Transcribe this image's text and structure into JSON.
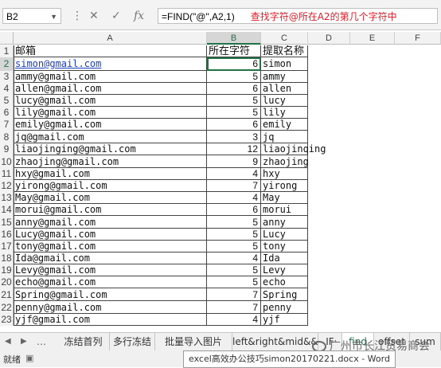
{
  "formula_bar": {
    "name_box": "B2",
    "formula": "=FIND(\"@\",A2,1)",
    "note": "查找字符@所在A2的第几个字符中",
    "note_color": "#e0202a",
    "icons": [
      "dropdown-icon",
      "cancel-icon",
      "confirm-icon",
      "fx-icon"
    ]
  },
  "columns": [
    "A",
    "B",
    "C",
    "D",
    "E",
    "F"
  ],
  "selected_cell": "B2",
  "table": {
    "headers": {
      "email": "邮箱",
      "position": "所在字符",
      "name": "提取名称"
    },
    "rows": [
      {
        "email": "simon@gmail.com",
        "pos": "6",
        "name": "simon"
      },
      {
        "email": "ammy@gmail.com",
        "pos": "5",
        "name": "ammy"
      },
      {
        "email": "allen@gmail.com",
        "pos": "6",
        "name": "allen"
      },
      {
        "email": "lucy@gmail.com",
        "pos": "5",
        "name": "lucy"
      },
      {
        "email": "lily@gmail.com",
        "pos": "5",
        "name": "lily"
      },
      {
        "email": "emily@gmail.com",
        "pos": "6",
        "name": "emily"
      },
      {
        "email": "jq@gmail.com",
        "pos": "3",
        "name": "jq"
      },
      {
        "email": "liaojinging@gmail.com",
        "pos": "12",
        "name": "liaojinqing"
      },
      {
        "email": "zhaojing@gmail.com",
        "pos": "9",
        "name": "zhaojing"
      },
      {
        "email": "hxy@gmail.com",
        "pos": "4",
        "name": "hxy"
      },
      {
        "email": "yirong@gmail.com",
        "pos": "7",
        "name": "yirong"
      },
      {
        "email": "May@gmail.com",
        "pos": "4",
        "name": "May"
      },
      {
        "email": "morui@gmail.com",
        "pos": "6",
        "name": "morui"
      },
      {
        "email": "anny@gmail.com",
        "pos": "5",
        "name": "anny"
      },
      {
        "email": "Lucy@gmail.com",
        "pos": "5",
        "name": "Lucy"
      },
      {
        "email": "tony@gmail.com",
        "pos": "5",
        "name": "tony"
      },
      {
        "email": "Ida@gmail.com",
        "pos": "4",
        "name": "Ida"
      },
      {
        "email": "Levy@gmail.com",
        "pos": "5",
        "name": "Levy"
      },
      {
        "email": "echo@gmail.com",
        "pos": "5",
        "name": "echo"
      },
      {
        "email": "Spring@gmail.com",
        "pos": "7",
        "name": "Spring"
      },
      {
        "email": "penny@gmail.com",
        "pos": "7",
        "name": "penny"
      },
      {
        "email": "yjf@gmail.com",
        "pos": "4",
        "name": "yjf"
      }
    ]
  },
  "row_numbers": [
    "1",
    "2",
    "3",
    "4",
    "5",
    "6",
    "7",
    "8",
    "9",
    "10",
    "11",
    "12",
    "13",
    "14",
    "15",
    "16",
    "17",
    "18",
    "19",
    "20",
    "21",
    "22",
    "23"
  ],
  "sheet_tabs": [
    "冻结首列",
    "多行冻结",
    "批量导入图片",
    "left&right&mid&&",
    "IF",
    "find",
    "offset",
    "sum"
  ],
  "active_tab": "find",
  "status": {
    "left": "就绪",
    "taskbar_item": "excel高效办公技巧simon20170221.docx - Word"
  },
  "watermark": "广州市长江贸易商会",
  "accent": "#217346"
}
